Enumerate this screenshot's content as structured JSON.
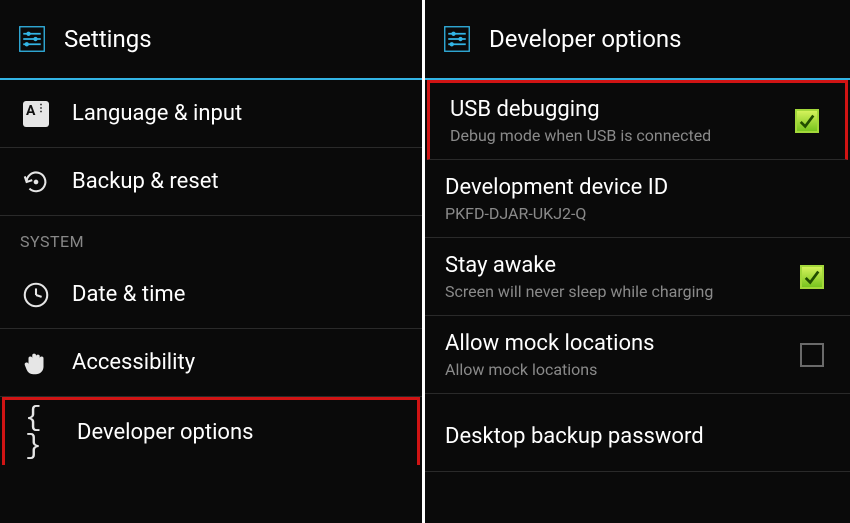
{
  "left": {
    "headerTitle": "Settings",
    "items": [
      {
        "label": "Language & input"
      },
      {
        "label": "Backup & reset"
      }
    ],
    "sectionHeader": "SYSTEM",
    "systemItems": [
      {
        "label": "Date & time"
      },
      {
        "label": "Accessibility"
      },
      {
        "label": "Developer options",
        "highlighted": true
      }
    ]
  },
  "right": {
    "headerTitle": "Developer options",
    "rows": [
      {
        "title": "USB debugging",
        "subtitle": "Debug mode when USB is connected",
        "checked": true,
        "highlighted": true
      },
      {
        "title": "Development device ID",
        "subtitle": "PKFD-DJAR-UKJ2-Q",
        "checkbox": false
      },
      {
        "title": "Stay awake",
        "subtitle": "Screen will never sleep while charging",
        "checked": true
      },
      {
        "title": "Allow mock locations",
        "subtitle": "Allow mock locations",
        "checked": false
      },
      {
        "title": "Desktop backup password",
        "subtitle": "",
        "checkbox": false
      }
    ]
  }
}
